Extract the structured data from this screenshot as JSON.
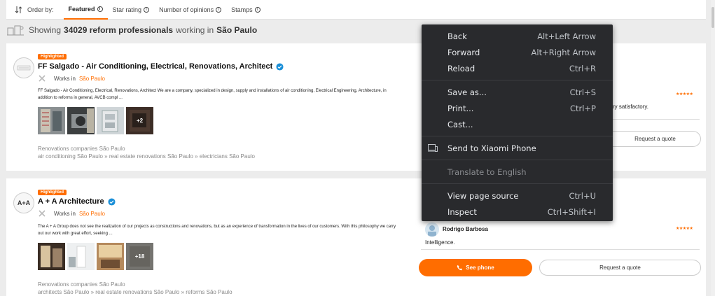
{
  "sortbar": {
    "order_label": "Order by:",
    "options": [
      "Featured",
      "Star rating",
      "Number of opinions",
      "Stamps"
    ],
    "active": "Featured",
    "info_glyph": "i"
  },
  "showing": {
    "prefix": "Showing",
    "count_text": "34029 reform professionals",
    "middle": "working in",
    "city": "São Paulo"
  },
  "cards": [
    {
      "badge": "Highlighted",
      "name": "FF Salgado - Air Conditioning, Electrical, Renovations, Architect",
      "works_in": "Works in",
      "city": "São Paulo",
      "description": "FF Salgado - Air Conditioning, Electrical, Renovations, Architect We are a company, specialized in design, supply and installations of air conditioning, Electrical Engineering, Architecture, in addition to reforms in general, AVCB compl ...",
      "more_photos": "+2",
      "category": "Renovations companies São Paulo",
      "tags": [
        "air conditioning São Paulo",
        "real estate renovations São Paulo",
        "electricians São Paulo"
      ],
      "review_text": "ry satisfactory.",
      "quote_button": "Request a quote"
    },
    {
      "badge": "Highlighted",
      "name": "A + A Architecture",
      "works_in": "Works in",
      "city": "São Paulo",
      "logo_text": "A+A",
      "description": "The A + A Group does not see the realization of our projects as constructions and renovations, but as an experience of transformation in the lives of our customers. With this philosophy we carry out our work with great effort, seeking ...",
      "more_photos": "+18",
      "category": "Renovations companies São Paulo",
      "tags": [
        "architects São Paulo",
        "real estate renovations São Paulo",
        "reforms São Paulo"
      ],
      "reviewer": "Rodrigo Barbosa",
      "review_text": "Intelligence.",
      "phone_button": "See phone",
      "quote_button": "Request a quote"
    }
  ],
  "stars": "★★★★★",
  "tag_separator": " » ",
  "context_menu": {
    "items": [
      {
        "label": "Back",
        "shortcut": "Alt+Left Arrow"
      },
      {
        "label": "Forward",
        "shortcut": "Alt+Right Arrow"
      },
      {
        "label": "Reload",
        "shortcut": "Ctrl+R"
      },
      {
        "label": "Save as...",
        "shortcut": "Ctrl+S"
      },
      {
        "label": "Print...",
        "shortcut": "Ctrl+P"
      },
      {
        "label": "Cast...",
        "shortcut": ""
      },
      {
        "label": "Send to Xiaomi Phone",
        "shortcut": ""
      },
      {
        "label": "Translate to English",
        "shortcut": ""
      },
      {
        "label": "View page source",
        "shortcut": "Ctrl+U"
      },
      {
        "label": "Inspect",
        "shortcut": "Ctrl+Shift+I"
      }
    ]
  },
  "colors": {
    "accent": "#ff6d00",
    "menu_bg": "#292a2d",
    "verified": "#1a8fd8"
  }
}
